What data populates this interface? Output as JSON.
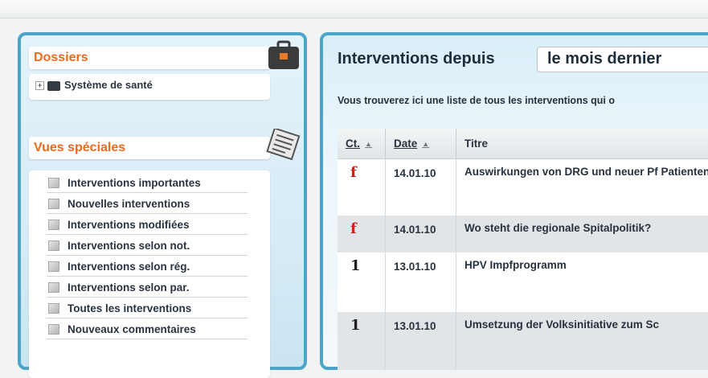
{
  "left": {
    "dossiers": {
      "title": "Dossiers",
      "icon": "briefcase-icon",
      "tree_item": "Système de santé"
    },
    "vues": {
      "title": "Vues spéciales",
      "icon": "document-icon",
      "items": [
        "Interventions importantes",
        "Nouvelles interventions",
        "Interventions modifiées",
        "Interventions selon not.",
        "Interventions selon rég.",
        "Interventions selon par.",
        "Toutes les interventions",
        "Nouveaux commentaires"
      ]
    }
  },
  "right": {
    "title": "Interventions depuis",
    "period_select": "le mois dernier",
    "description": "Vous trouverez ici une liste de tous les interventions qui o",
    "table": {
      "headers": {
        "cat": "Ct.",
        "date": "Date",
        "title": "Titre"
      },
      "rows": [
        {
          "cat": "f",
          "date": "14.01.10",
          "title": "Auswirkungen von DRG und neuer Pf Patienten"
        },
        {
          "cat": "f",
          "date": "14.01.10",
          "title": "Wo steht die regionale Spitalpolitik?"
        },
        {
          "cat": "1",
          "date": "13.01.10",
          "title": "HPV Impfprogramm"
        },
        {
          "cat": "1",
          "date": "13.01.10",
          "title": "Umsetzung der Volksinitiative zum Sc"
        }
      ]
    }
  },
  "colors": {
    "accent_orange": "#ee6a1a",
    "panel_border": "#4da4c8",
    "category_red": "#d1201a"
  }
}
